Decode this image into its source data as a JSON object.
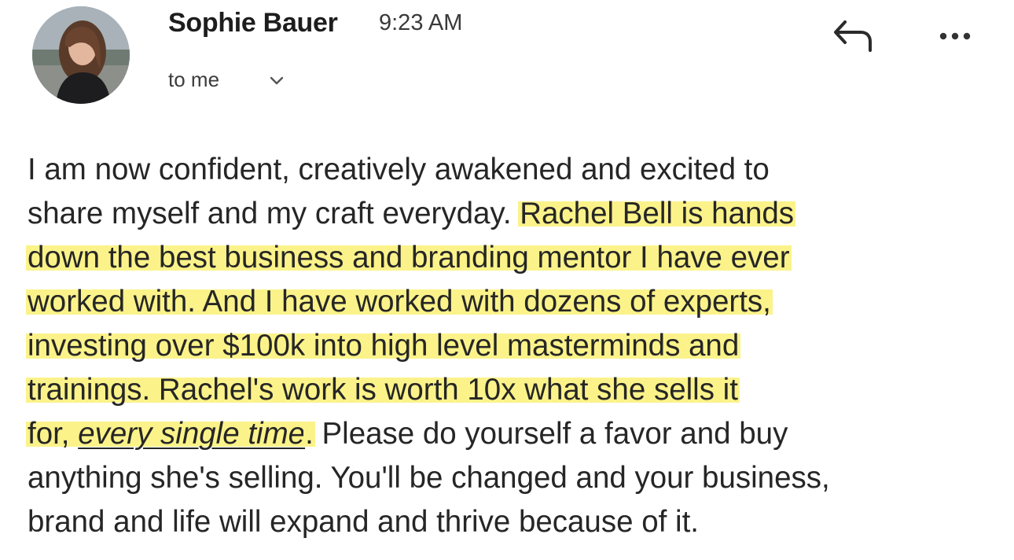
{
  "header": {
    "sender_name": "Sophie Bauer",
    "time": "9:23 AM",
    "recipient": "to me",
    "icons": {
      "avatar": "avatar",
      "chevron": "chevron-down-icon",
      "reply": "reply-icon",
      "more": "more-horizontal-icon"
    }
  },
  "message": {
    "highlight_color": "#fbf38a",
    "lines": [
      [
        {
          "text": "I am now confident, creatively awakened and excited to",
          "highlight": false
        }
      ],
      [
        {
          "text": "share myself and my craft everyday. ",
          "highlight": false
        },
        {
          "text": "Rachel Bell is hands",
          "highlight": true
        }
      ],
      [
        {
          "text": "down the best business and branding mentor I have ever",
          "highlight": true
        }
      ],
      [
        {
          "text": "worked with. And I have worked with dozens of experts,",
          "highlight": true
        }
      ],
      [
        {
          "text": "investing over $100k into high level masterminds and",
          "highlight": true
        }
      ],
      [
        {
          "text": "trainings. Rachel's work is worth 10x what she sells it",
          "highlight": true
        }
      ],
      [
        {
          "text": "for, ",
          "highlight": true
        },
        {
          "text": "every single time",
          "highlight": true,
          "underline": true,
          "italic": true
        },
        {
          "text": ".",
          "highlight": true
        },
        {
          "text": " Please do yourself a favor and buy",
          "highlight": false
        }
      ],
      [
        {
          "text": "anything she's selling. You'll be changed and your business,",
          "highlight": false
        }
      ],
      [
        {
          "text": "brand and life will expand and thrive because of it.",
          "highlight": false
        }
      ]
    ]
  }
}
